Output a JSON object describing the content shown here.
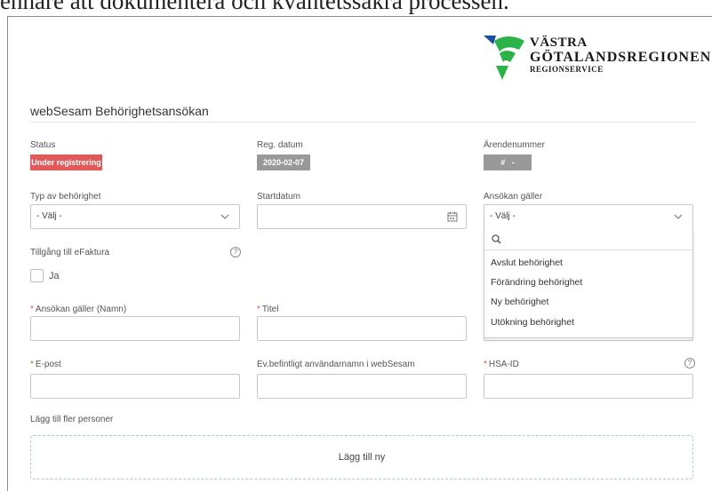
{
  "doc": {
    "top_text": "enhare att dokumentera och kvantetssäkra processen."
  },
  "logo": {
    "line1": "VÄSTRA",
    "line2": "GÖTALANDSREGIONEN",
    "line3": "REGIONSERVICE"
  },
  "page_title": "webSesam Behörighetsansökan",
  "status": {
    "label": "Status",
    "badge": "Under registrering"
  },
  "reg_datum": {
    "label": "Reg. datum",
    "value": "2020-02-07"
  },
  "arendenummer": {
    "label": "Ärendenummer",
    "value": "#   -"
  },
  "typ": {
    "label": "Typ av behörighet",
    "value": "- Välj -"
  },
  "startdatum": {
    "label": "Startdatum",
    "value": ""
  },
  "ansokan": {
    "label": "Ansökan gäller",
    "value": "- Välj -"
  },
  "dropdown": {
    "options": [
      "Avslut behörighet",
      "Förändring behörighet",
      "Ny behörighet",
      "Utökning behörighet"
    ]
  },
  "efaktura": {
    "label": "Tillgång till eFaktura",
    "checkbox_label": "Ja",
    "help": "?"
  },
  "required_marker": "*",
  "namn": {
    "label": "Ansökan gäller (Namn)"
  },
  "titel": {
    "label": "Titel"
  },
  "epost": {
    "label": "E-post"
  },
  "anvandarnamn": {
    "label": "Ev.befintligt användarnamn i webSesam"
  },
  "hsaid": {
    "label": "HSA-ID",
    "help": "?"
  },
  "fler": {
    "label": "Lägg till fler personer",
    "button": "Lägg till ny"
  },
  "colors": {
    "status_red": "#e05a5a",
    "badge_grey": "#999999",
    "dashed_blue": "#a9c6e6",
    "logo_green": "#2bb34a",
    "logo_blue": "#1d4f9c"
  }
}
